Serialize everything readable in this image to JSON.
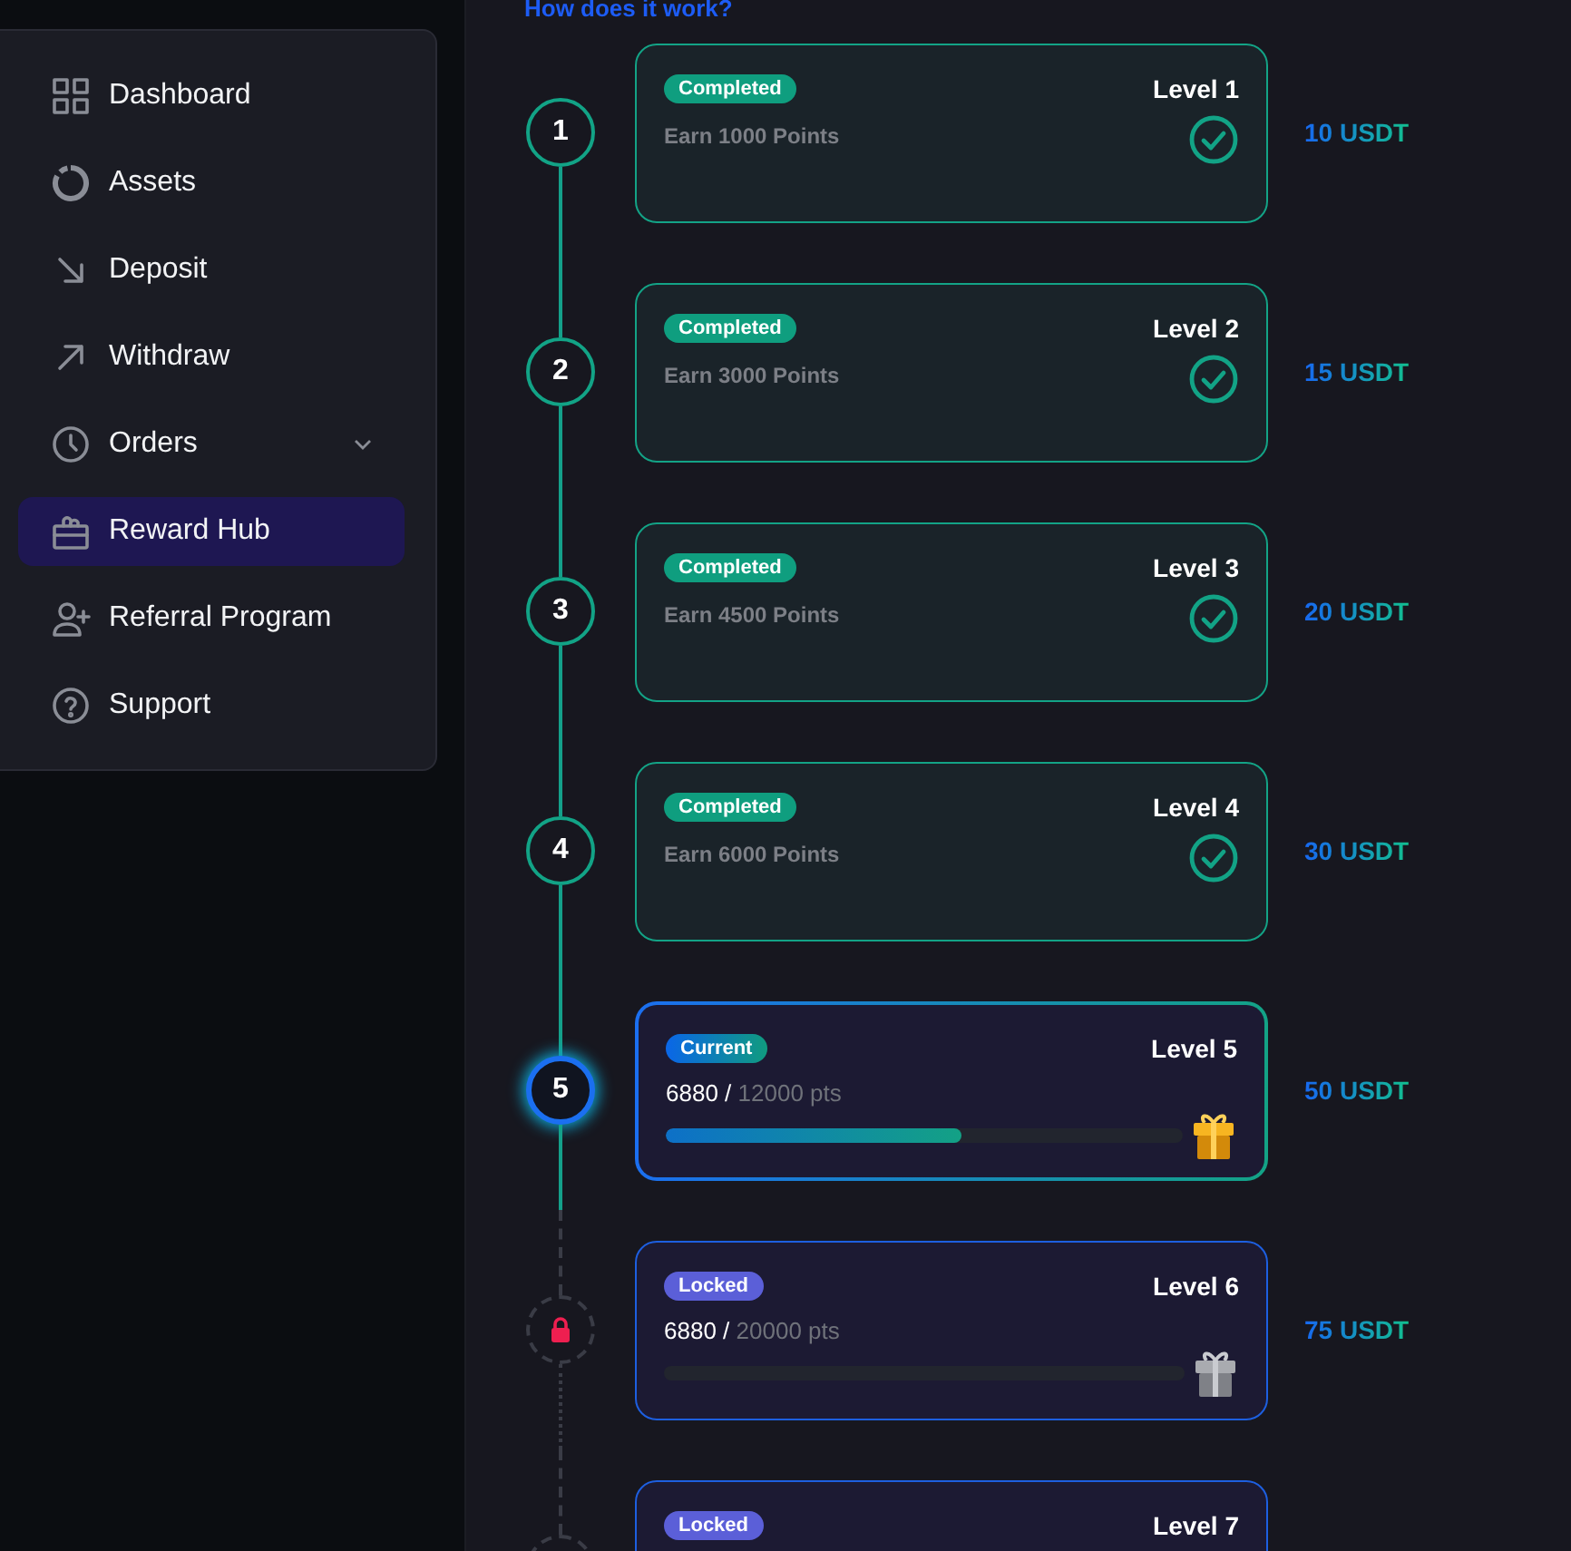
{
  "sidebar": {
    "items": [
      {
        "label": "Dashboard",
        "selected": false
      },
      {
        "label": "Assets",
        "selected": false
      },
      {
        "label": "Deposit",
        "selected": false
      },
      {
        "label": "Withdraw",
        "selected": false
      },
      {
        "label": "Orders",
        "selected": false,
        "expandable": true
      },
      {
        "label": "Reward Hub",
        "selected": true
      },
      {
        "label": "Referral Program",
        "selected": false
      },
      {
        "label": "Support",
        "selected": false
      }
    ]
  },
  "help_link": "How does it work?",
  "levels": [
    {
      "kind": "completed",
      "number": "1",
      "badge": "Completed",
      "title": "Level 1",
      "description": "Earn 1000 Points",
      "reward": "10 USDT"
    },
    {
      "kind": "completed",
      "number": "2",
      "badge": "Completed",
      "title": "Level 2",
      "description": "Earn 3000 Points",
      "reward": "15 USDT"
    },
    {
      "kind": "completed",
      "number": "3",
      "badge": "Completed",
      "title": "Level 3",
      "description": "Earn 4500 Points",
      "reward": "20 USDT"
    },
    {
      "kind": "completed",
      "number": "4",
      "badge": "Completed",
      "title": "Level 4",
      "description": "Earn 6000 Points",
      "reward": "30 USDT"
    },
    {
      "kind": "current",
      "number": "5",
      "badge": "Current",
      "title": "Level 5",
      "points": "6880 /",
      "goal": "12000 pts",
      "level": 0.573,
      "reward": "50 USDT"
    },
    {
      "kind": "locked",
      "badge": "Locked",
      "title": "Level 6",
      "points": "6880 /",
      "goal": "20000 pts",
      "level": 0,
      "reward": "75 USDT"
    },
    {
      "kind": "locked",
      "badge": "Locked",
      "title": "Level 7"
    }
  ]
}
